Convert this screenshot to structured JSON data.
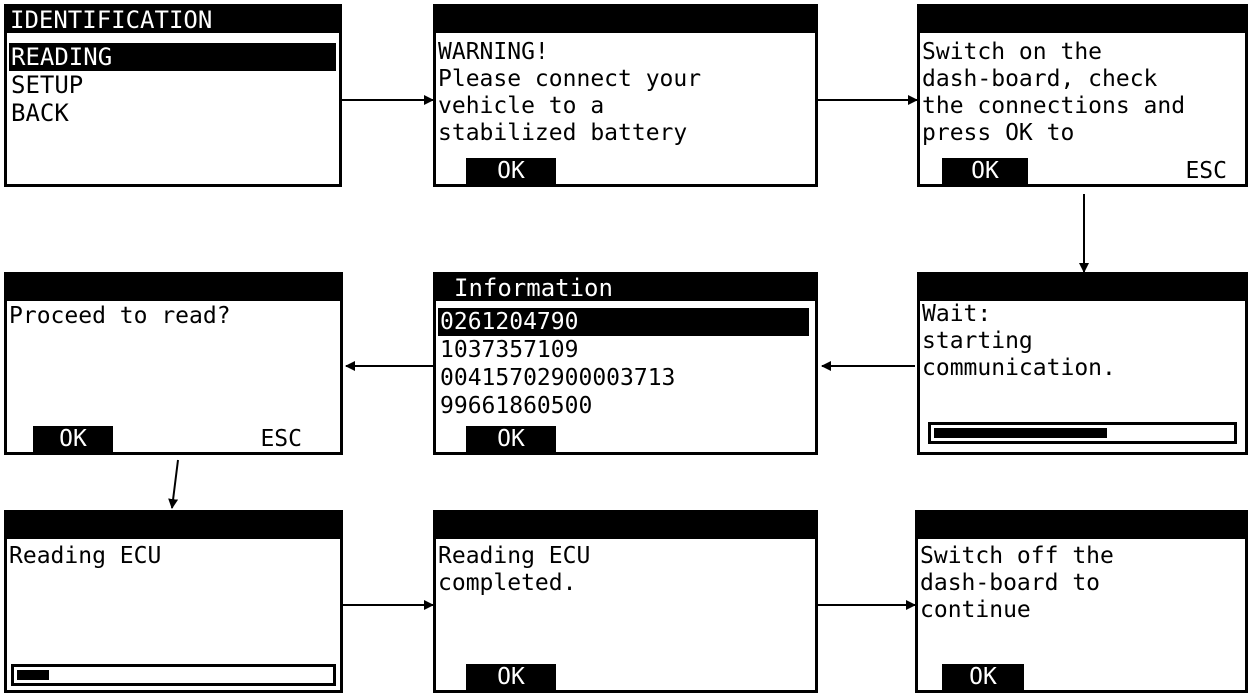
{
  "screens": {
    "identification": {
      "title": "IDENTIFICATION",
      "items": [
        "READING",
        "SETUP",
        "BACK"
      ]
    },
    "warning": {
      "lines": [
        "WARNING!",
        "Please connect your",
        "vehicle to a",
        "stabilized battery"
      ],
      "ok": "OK"
    },
    "switch_on": {
      "lines": [
        "Switch on the",
        "dash-board, check",
        "the connections and",
        "press OK to"
      ],
      "ok": "OK",
      "esc": "ESC"
    },
    "wait": {
      "lines": [
        "Wait:",
        "starting",
        "communication."
      ],
      "progress": 0.59
    },
    "information": {
      "title": "Information",
      "items": [
        "0261204790",
        "1037357109",
        "00415702900003713",
        "99661860500"
      ],
      "ok": "OK"
    },
    "proceed": {
      "lines": [
        "Proceed to read?"
      ],
      "ok": "OK",
      "esc": "ESC"
    },
    "reading": {
      "lines": [
        "Reading ECU"
      ],
      "progress": 0.12
    },
    "completed": {
      "lines": [
        "Reading ECU",
        "completed."
      ],
      "ok": "OK"
    },
    "switch_off": {
      "lines": [
        "Switch off the",
        "dash-board to",
        "continue"
      ],
      "ok": "OK"
    }
  }
}
